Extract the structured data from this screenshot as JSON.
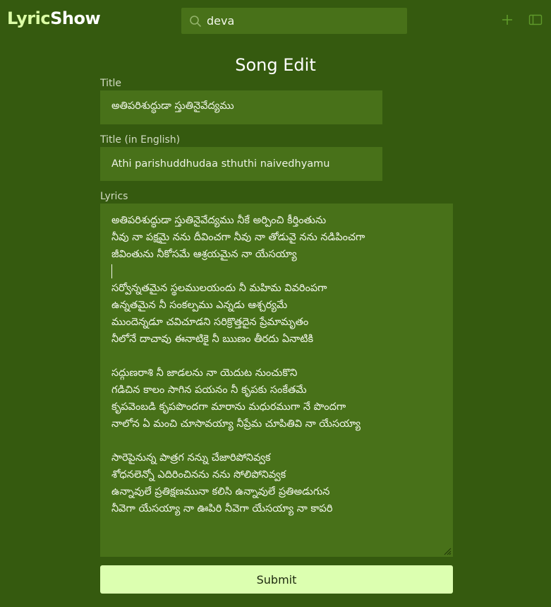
{
  "app": {
    "logo_part1": "Lyric",
    "logo_part2": "Show"
  },
  "search": {
    "value": "deva"
  },
  "page": {
    "title": "Song Edit"
  },
  "form": {
    "title_label": "Title",
    "title_value": "అతిపరిశుద్ధుడా స్తుతినైవేద్యము",
    "title_en_label": "Title (in English)",
    "title_en_value": "Athi parishuddhudaa sthuthi naivedhyamu",
    "lyrics_label": "Lyrics",
    "lyrics_lines": [
      "అతిపరిశుద్ధుడా స్తుతినైవేద్యము నీకే అర్పించి కీర్తింతును",
      "నీవు నా పక్షమై నను దీవించగా నీవు నా తోడువై నను నడిపించగా",
      "జీవింతును నీకోసమే ఆశ్రయమైన నా యేసయ్యా",
      "",
      "సర్వోన్నతమైన స్థలములయందు నీ మహిమ వివరింపగా",
      "ఉన్నతమైన నీ సంకల్పము ఎన్నడు ఆశ్చర్యమే",
      "ముందెన్నడూ చవిచూడని సరిక్రొత్తదైన ప్రేమామృతం",
      "నీలోనే దాచావు ఈనాటికై నీ ఋణం తీరదు ఏనాటికి",
      "",
      "సద్గుణరాశి నీ జాడలను నా యెదుట నుంచుకొని",
      "గడిచిన కాలం సాగిన పయనం నీ కృపకు సంకేతమే",
      "కృపవెంబడి కృపపొందగా మారాను మధురముగా నే పొందగా",
      "నాలోన ఏ మంచి చూసావయ్యా నీప్రేమ చూపితివి నా యేసయ్యా",
      "",
      "సారెపైనున్న పాత్రగ నన్ను చేజారిపోనివ్వక",
      "శోధనలెన్నో ఎదిరించినను నను సోలిపోనివ్వక",
      "ఉన్నావులే ప్రతిక్షణమునా కలిసి ఉన్నావులే ప్రతిఅడుగున",
      "నీవెగా యేసయ్యా నా ఊపిరి నీవెగా యేసయ్యా నా కాపరి"
    ],
    "submit_label": "Submit"
  },
  "colors": {
    "background": "#355a0f",
    "input_bg": "#487119",
    "accent": "#dcffa6",
    "button_bg": "#dcffb0"
  },
  "icons": [
    "search-icon",
    "plus-icon",
    "sidebar-toggle-icon",
    "resize-grip-icon"
  ]
}
